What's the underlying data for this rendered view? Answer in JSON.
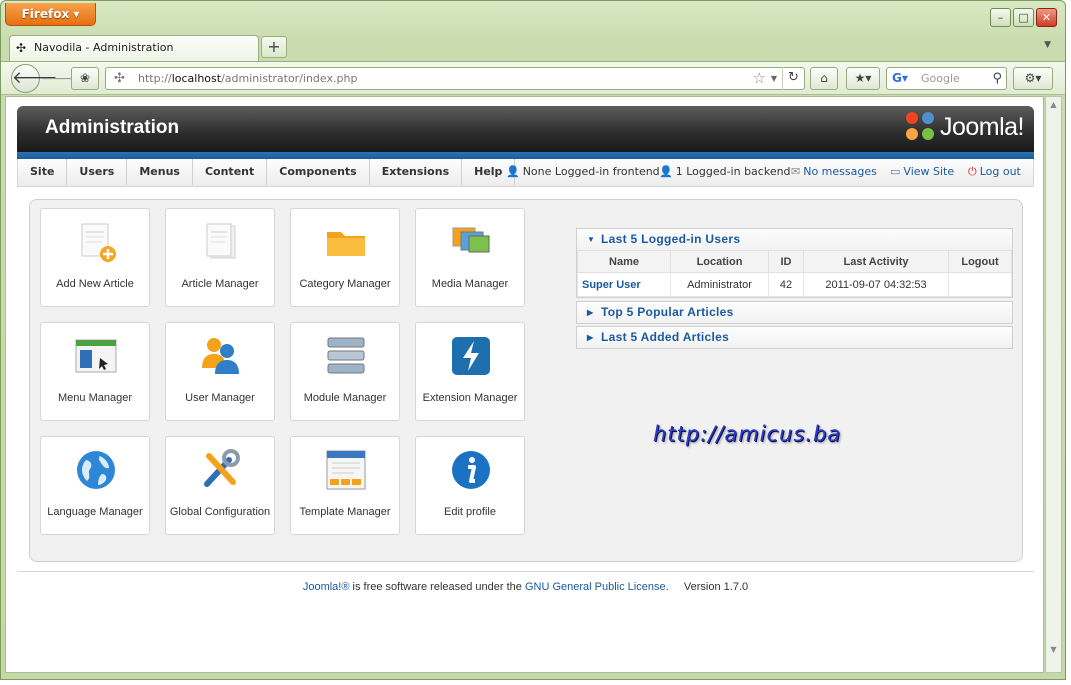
{
  "browser": {
    "app_button": "Firefox ▾",
    "tab_title": "Navodila - Administration",
    "url_prefix": "http://",
    "url_host": "localhost",
    "url_path": "/administrator/index.php",
    "search_placeholder": "Google"
  },
  "header": {
    "title": "Administration",
    "logo_text": "Joomla!"
  },
  "menu": {
    "items": [
      "Site",
      "Users",
      "Menus",
      "Content",
      "Components",
      "Extensions",
      "Help"
    ]
  },
  "status": {
    "frontend": "None Logged-in frontend",
    "backend": "1 Logged-in backend",
    "messages": "No messages",
    "view_site": "View Site",
    "logout": "Log out"
  },
  "icons": [
    {
      "label": "Add New Article",
      "icon": "add-article-icon"
    },
    {
      "label": "Article Manager",
      "icon": "article-icon"
    },
    {
      "label": "Category Manager",
      "icon": "folder-icon"
    },
    {
      "label": "Media Manager",
      "icon": "media-icon"
    },
    {
      "label": "Menu Manager",
      "icon": "menu-icon"
    },
    {
      "label": "User Manager",
      "icon": "users-icon"
    },
    {
      "label": "Module Manager",
      "icon": "module-icon"
    },
    {
      "label": "Extension Manager",
      "icon": "extension-icon"
    },
    {
      "label": "Language Manager",
      "icon": "globe-icon"
    },
    {
      "label": "Global Configuration",
      "icon": "tools-icon"
    },
    {
      "label": "Template Manager",
      "icon": "template-icon"
    },
    {
      "label": "Edit profile",
      "icon": "info-icon"
    }
  ],
  "modules": {
    "logged_in": {
      "title": "Last 5 Logged-in Users",
      "columns": [
        "Name",
        "Location",
        "ID",
        "Last Activity",
        "Logout"
      ],
      "rows": [
        {
          "name": "Super User",
          "location": "Administrator",
          "id": "42",
          "last_activity": "2011-09-07 04:32:53",
          "logout": ""
        }
      ]
    },
    "popular": {
      "title": "Top 5 Popular Articles"
    },
    "added": {
      "title": "Last 5 Added Articles"
    }
  },
  "watermark": "http://amicus.ba",
  "footer": {
    "joomla_link": "Joomla!®",
    "text_mid": " is free software released under the ",
    "license_link": "GNU General Public License",
    "text_end": ".",
    "version": "Version 1.7.0"
  }
}
